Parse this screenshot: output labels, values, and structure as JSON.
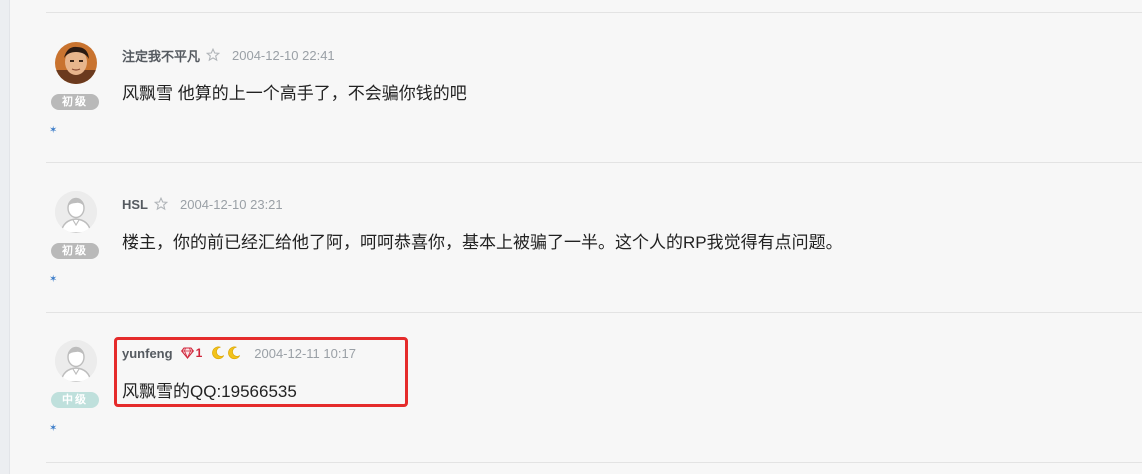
{
  "posts": [
    {
      "author": "注定我不平凡",
      "time": "2004-12-10 22:41",
      "level": "初级",
      "content": "风飘雪 他算的上一个高手了，不会骗你钱的吧",
      "avatar": "photo"
    },
    {
      "author": "HSL",
      "time": "2004-12-10 23:21",
      "level": "初级",
      "content": "楼主，你的前已经汇给他了阿，呵呵恭喜你，基本上被骗了一半。这个人的RP我觉得有点问题。",
      "avatar": "default"
    },
    {
      "author": "yunfeng",
      "gem_count": "1",
      "time": "2004-12-11 10:17",
      "level": "中级",
      "content": "风飘雪的QQ:19566535",
      "avatar": "default"
    }
  ],
  "colors": {
    "highlight": "#e52b2b",
    "level_basic": "#b9b9b9",
    "level_mid": "#bfe0dc",
    "gem": "#d0253a",
    "moon": "#f2c21b"
  }
}
